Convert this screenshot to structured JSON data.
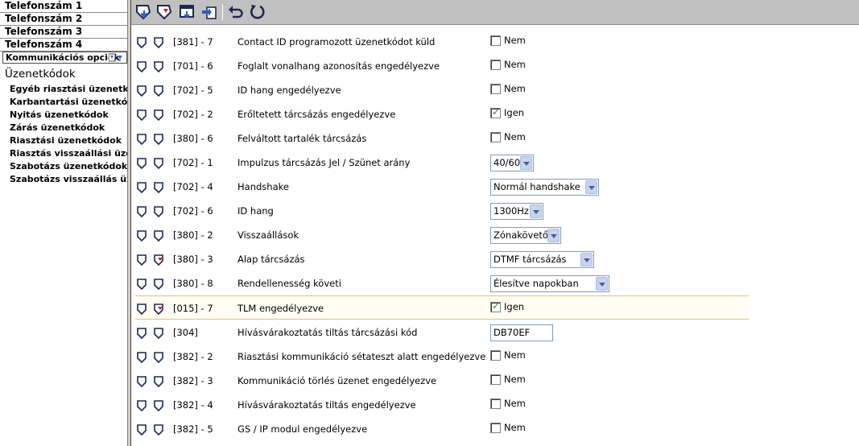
{
  "sidebar": {
    "phone_items": [
      "Telefonszám 1",
      "Telefonszám 2",
      "Telefonszám 3",
      "Telefonszám 4"
    ],
    "komm_label": "Kommunikációs opciók",
    "section_title": "Üzenetkódok",
    "sub_items": [
      "Egyéb riasztási üzenetkódok",
      "Karbantartási üzenetkódok",
      "Nyitás üzenetkódok",
      "Zárás üzenetkódok",
      "Riasztási üzenetkódok",
      "Riasztás visszaállási üzenetkódok",
      "Szabotázs üzenetkódok",
      "Szabotázs visszaállás üzenetkódok"
    ]
  },
  "toolbar": {
    "icons": [
      "download-icon",
      "upload-icon",
      "window-icon",
      "transfer-icon",
      "undo-icon",
      "refresh-icon"
    ]
  },
  "colors": {
    "toolbar_bg": "#c0c0c0",
    "highlight_border": "#e6c26f",
    "check_green": "#1f8f1f"
  },
  "rows": [
    {
      "code": "[381] - 7",
      "desc": "Contact ID programozott üzenetkódot küld",
      "kind": "check",
      "checked": false,
      "value": "Nem",
      "flag": false
    },
    {
      "code": "[701] - 6",
      "desc": "Foglalt vonalhang azonosítás engedélyezve",
      "kind": "check",
      "checked": false,
      "value": "Nem",
      "flag": false
    },
    {
      "code": "[702] - 5",
      "desc": "ID hang engedélyezve",
      "kind": "check",
      "checked": false,
      "value": "Nem",
      "flag": false
    },
    {
      "code": "[702] - 2",
      "desc": "Erőltetett tárcsázás engedélyezve",
      "kind": "check",
      "checked": true,
      "value": "Igen",
      "flag": false
    },
    {
      "code": "[380] - 6",
      "desc": "Felváltott tartalék tárcsázás",
      "kind": "check",
      "checked": false,
      "value": "Nem",
      "flag": false
    },
    {
      "code": "[702] - 1",
      "desc": "Impulzus tárcsázás Jel / Szünet arány",
      "kind": "select",
      "value": "40/60",
      "flag": false
    },
    {
      "code": "[702] - 4",
      "desc": "Handshake",
      "kind": "select",
      "value": "Normál handshake",
      "flag": false
    },
    {
      "code": "[702] - 6",
      "desc": "ID hang",
      "kind": "select",
      "value": "1300Hz",
      "flag": false
    },
    {
      "code": "[380] - 2",
      "desc": "Visszaállások",
      "kind": "select",
      "value": "Zónakövető",
      "flag": false
    },
    {
      "code": "[380] - 3",
      "desc": "Alap tárcsázás",
      "kind": "select",
      "value": "DTMF tárcsázás",
      "flag": true
    },
    {
      "code": "[380] - 8",
      "desc": "Rendellenesség követi",
      "kind": "select",
      "value": "Élesítve napokban",
      "flag": false
    },
    {
      "code": "[015] - 7",
      "desc": "TLM engedélyezve",
      "kind": "check",
      "checked": true,
      "value": "Igen",
      "flag": true,
      "highlight": true
    },
    {
      "code": "[304]",
      "desc": "Hívásvárakoztatás tiltás tárcsázási kód",
      "kind": "text",
      "value": "DB70EF",
      "flag": false
    },
    {
      "code": "[382] - 2",
      "desc": "Riasztási kommunikáció sétateszt alatt engedélyezve",
      "kind": "check",
      "checked": false,
      "value": "Nem",
      "flag": false
    },
    {
      "code": "[382] - 3",
      "desc": "Kommunikáció törlés üzenet engedélyezve",
      "kind": "check",
      "checked": false,
      "value": "Nem",
      "flag": false
    },
    {
      "code": "[382] - 4",
      "desc": "Hívásvárakoztatás tiltás engedélyezve",
      "kind": "check",
      "checked": false,
      "value": "Nem",
      "flag": false
    },
    {
      "code": "[382] - 5",
      "desc": "GS / IP modul engedélyezve",
      "kind": "check",
      "checked": false,
      "value": "Nem",
      "flag": false
    }
  ]
}
